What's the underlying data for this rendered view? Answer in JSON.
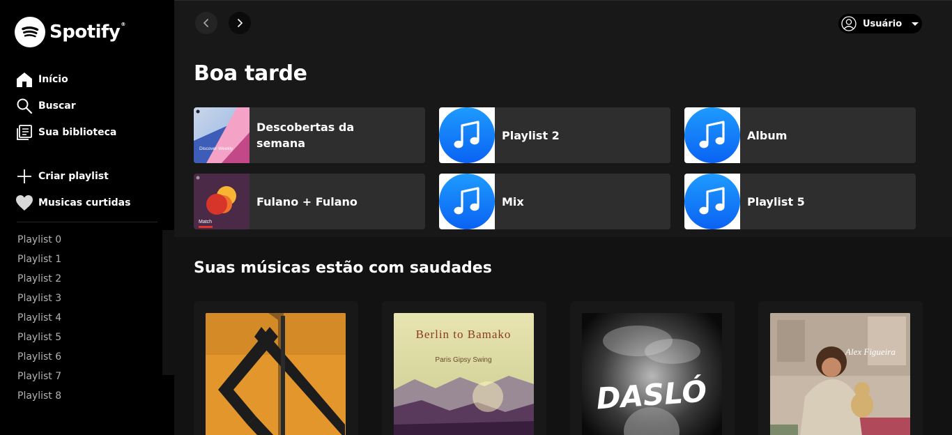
{
  "brand": {
    "name": "Spotify",
    "reg": "®"
  },
  "sidebar": {
    "nav": [
      {
        "label": "Início",
        "icon": "home-icon"
      },
      {
        "label": "Buscar",
        "icon": "search-icon"
      },
      {
        "label": "Sua biblioteca",
        "icon": "library-icon"
      }
    ],
    "actions": [
      {
        "label": "Criar playlist",
        "icon": "plus-icon"
      },
      {
        "label": "Musicas curtidas",
        "icon": "heart-icon"
      }
    ],
    "playlists": [
      "Playlist 0",
      "Playlist 1",
      "Playlist 2",
      "Playlist 3",
      "Playlist 4",
      "Playlist 5",
      "Playlist 6",
      "Playlist 7",
      "Playlist 8"
    ]
  },
  "header": {
    "user_name": "Usuário"
  },
  "main": {
    "greeting": "Boa tarde",
    "shortcuts": [
      {
        "label": "Descobertas da semana",
        "art": "discover-weekly",
        "art_text": "Discover Weekly"
      },
      {
        "label": "Playlist 2",
        "art": "music-note"
      },
      {
        "label": "Album",
        "art": "music-note"
      },
      {
        "label": "Fulano + Fulano",
        "art": "match",
        "art_text": "Match"
      },
      {
        "label": "Mix",
        "art": "music-note"
      },
      {
        "label": "Playlist 5",
        "art": "music-note"
      }
    ],
    "section_title": "Suas músicas estão com saudades",
    "cards": [
      {
        "art": "abstract-orange"
      },
      {
        "art": "berlin-to-bamako",
        "title_text": "Berlin to Bamako",
        "subtitle_text": "Paris Gipsy Swing"
      },
      {
        "art": "daslo",
        "title_text": "DASLÓ"
      },
      {
        "art": "alex-figueira",
        "title_text": "Alex Figueira"
      }
    ]
  },
  "colors": {
    "background": "#121212",
    "sidebar": "#000000",
    "card": "#181818",
    "shortcut": "#2e2e2e",
    "text_muted": "#b3b3b3"
  }
}
